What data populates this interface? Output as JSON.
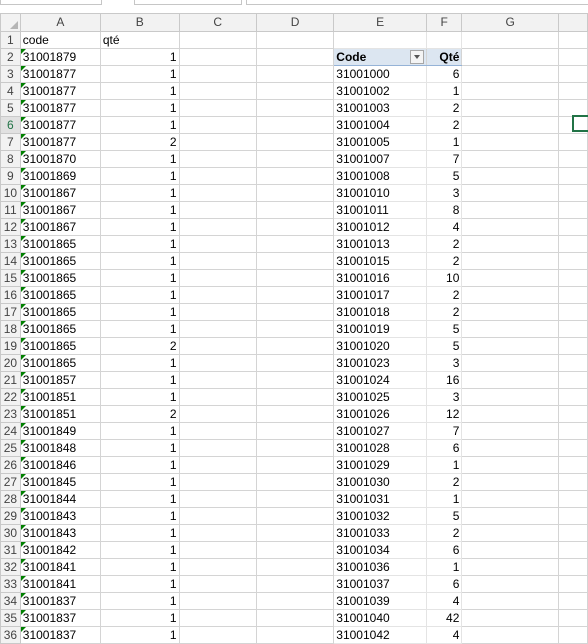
{
  "columns": [
    "A",
    "B",
    "C",
    "D",
    "E",
    "F",
    "G"
  ],
  "rows": [
    {
      "n": "1",
      "a": "code",
      "b": "qté",
      "e": "",
      "f": "",
      "kind": "header"
    },
    {
      "n": "2",
      "a": "31001879",
      "b": "1",
      "e": "Code",
      "f": "Qté",
      "kind": "pivothdr"
    },
    {
      "n": "3",
      "a": "31001877",
      "b": "1",
      "e": "31001000",
      "f": "6"
    },
    {
      "n": "4",
      "a": "31001877",
      "b": "1",
      "e": "31001002",
      "f": "1"
    },
    {
      "n": "5",
      "a": "31001877",
      "b": "1",
      "e": "31001003",
      "f": "2"
    },
    {
      "n": "6",
      "a": "31001877",
      "b": "1",
      "e": "31001004",
      "f": "2"
    },
    {
      "n": "7",
      "a": "31001877",
      "b": "2",
      "e": "31001005",
      "f": "1"
    },
    {
      "n": "8",
      "a": "31001870",
      "b": "1",
      "e": "31001007",
      "f": "7"
    },
    {
      "n": "9",
      "a": "31001869",
      "b": "1",
      "e": "31001008",
      "f": "5"
    },
    {
      "n": "10",
      "a": "31001867",
      "b": "1",
      "e": "31001010",
      "f": "3"
    },
    {
      "n": "11",
      "a": "31001867",
      "b": "1",
      "e": "31001011",
      "f": "8"
    },
    {
      "n": "12",
      "a": "31001867",
      "b": "1",
      "e": "31001012",
      "f": "4"
    },
    {
      "n": "13",
      "a": "31001865",
      "b": "1",
      "e": "31001013",
      "f": "2"
    },
    {
      "n": "14",
      "a": "31001865",
      "b": "1",
      "e": "31001015",
      "f": "2"
    },
    {
      "n": "15",
      "a": "31001865",
      "b": "1",
      "e": "31001016",
      "f": "10"
    },
    {
      "n": "16",
      "a": "31001865",
      "b": "1",
      "e": "31001017",
      "f": "2"
    },
    {
      "n": "17",
      "a": "31001865",
      "b": "1",
      "e": "31001018",
      "f": "2"
    },
    {
      "n": "18",
      "a": "31001865",
      "b": "1",
      "e": "31001019",
      "f": "5"
    },
    {
      "n": "19",
      "a": "31001865",
      "b": "2",
      "e": "31001020",
      "f": "5"
    },
    {
      "n": "20",
      "a": "31001865",
      "b": "1",
      "e": "31001023",
      "f": "3"
    },
    {
      "n": "21",
      "a": "31001857",
      "b": "1",
      "e": "31001024",
      "f": "16"
    },
    {
      "n": "22",
      "a": "31001851",
      "b": "1",
      "e": "31001025",
      "f": "3"
    },
    {
      "n": "23",
      "a": "31001851",
      "b": "2",
      "e": "31001026",
      "f": "12"
    },
    {
      "n": "24",
      "a": "31001849",
      "b": "1",
      "e": "31001027",
      "f": "7"
    },
    {
      "n": "25",
      "a": "31001848",
      "b": "1",
      "e": "31001028",
      "f": "6"
    },
    {
      "n": "26",
      "a": "31001846",
      "b": "1",
      "e": "31001029",
      "f": "1"
    },
    {
      "n": "27",
      "a": "31001845",
      "b": "1",
      "e": "31001030",
      "f": "2"
    },
    {
      "n": "28",
      "a": "31001844",
      "b": "1",
      "e": "31001031",
      "f": "1"
    },
    {
      "n": "29",
      "a": "31001843",
      "b": "1",
      "e": "31001032",
      "f": "5"
    },
    {
      "n": "30",
      "a": "31001843",
      "b": "1",
      "e": "31001033",
      "f": "2"
    },
    {
      "n": "31",
      "a": "31001842",
      "b": "1",
      "e": "31001034",
      "f": "6"
    },
    {
      "n": "32",
      "a": "31001841",
      "b": "1",
      "e": "31001036",
      "f": "1"
    },
    {
      "n": "33",
      "a": "31001841",
      "b": "1",
      "e": "31001037",
      "f": "6"
    },
    {
      "n": "34",
      "a": "31001837",
      "b": "1",
      "e": "31001039",
      "f": "4"
    },
    {
      "n": "35",
      "a": "31001837",
      "b": "1",
      "e": "31001040",
      "f": "42"
    },
    {
      "n": "36",
      "a": "31001837",
      "b": "1",
      "e": "31001042",
      "f": "4"
    }
  ],
  "selected_row": "6",
  "colors": {
    "accent": "#217346",
    "pivot_header": "#dce6f1",
    "comment_marker": "#008000"
  }
}
